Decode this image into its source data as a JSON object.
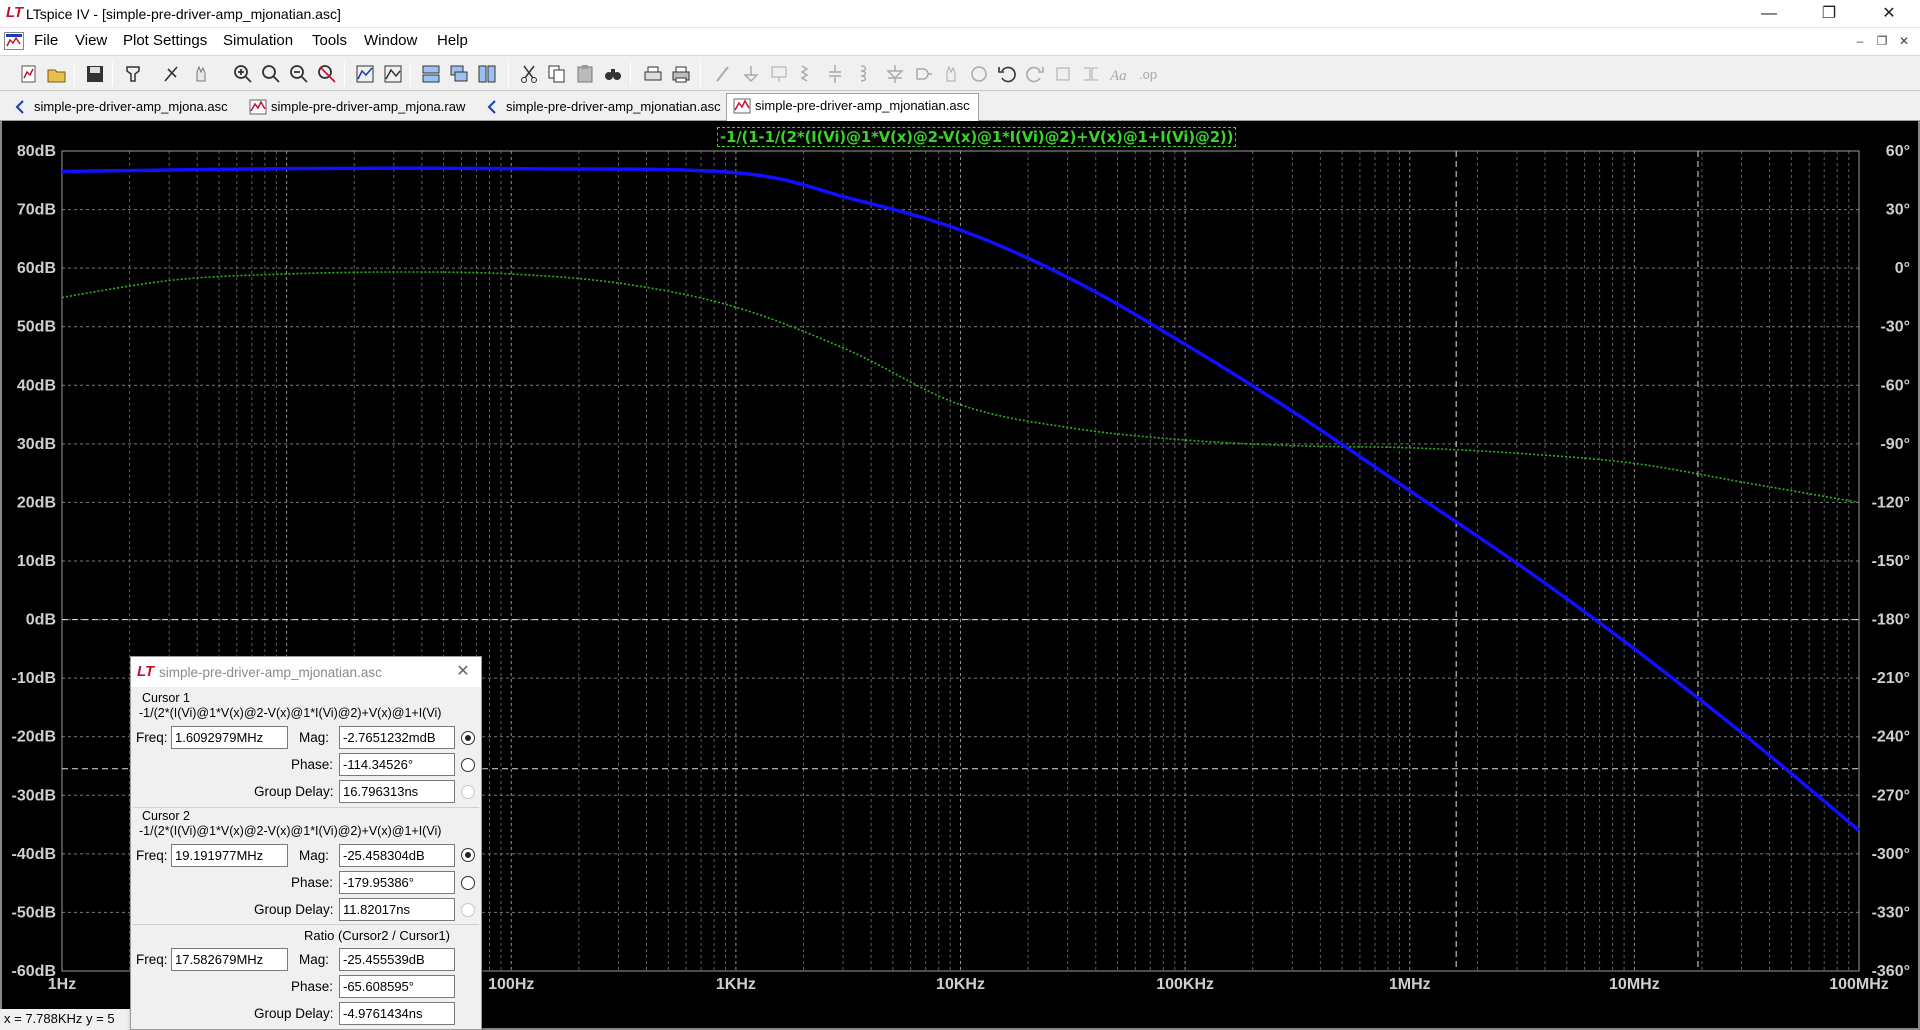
{
  "window": {
    "title": "LTspice IV - [simple-pre-driver-amp_mjonatian.asc]",
    "minimize": "—",
    "restore": "❐",
    "close": "✕"
  },
  "menu": {
    "items": [
      {
        "label": "File"
      },
      {
        "label": "View"
      },
      {
        "label": "Plot Settings"
      },
      {
        "label": "Simulation"
      },
      {
        "label": "Tools"
      },
      {
        "label": "Window"
      },
      {
        "label": "Help"
      }
    ],
    "mdi_minimize": "–",
    "mdi_restore": "❐",
    "mdi_close": "✕"
  },
  "tabs": [
    {
      "label": "simple-pre-driver-amp_mjona.asc",
      "icon": "schematic-icon"
    },
    {
      "label": "simple-pre-driver-amp_mjona.raw",
      "icon": "waveform-icon"
    },
    {
      "label": "simple-pre-driver-amp_mjonatian.asc",
      "icon": "schematic-icon"
    },
    {
      "label": "simple-pre-driver-amp_mjonatian.asc",
      "icon": "waveform-icon",
      "active": true
    }
  ],
  "plot": {
    "trace_expression": "-1/(1-1/(2*(I(Vi)@1*V(x)@2-V(x)@1*I(Vi)@2)+V(x)@1+I(Vi)@2))",
    "colors": {
      "magnitude": "#1010ff",
      "phase": "#2db51e",
      "grid": "#9a9a9a",
      "axis_text": "#cfcfcf"
    }
  },
  "chart_data": {
    "type": "line",
    "title": "-1/(1-1/(2*(I(Vi)@1*V(x)@2-V(x)@1*I(Vi)@2)+V(x)@1+I(Vi)@2))",
    "x_scale": "log",
    "x_ticks": [
      "1Hz",
      "10Hz",
      "100Hz",
      "1KHz",
      "10KHz",
      "100KHz",
      "1MHz",
      "10MHz",
      "100MHz"
    ],
    "y_left_ticks": [
      "80dB",
      "70dB",
      "60dB",
      "50dB",
      "40dB",
      "30dB",
      "20dB",
      "10dB",
      "0dB",
      "-10dB",
      "-20dB",
      "-30dB",
      "-40dB",
      "-50dB",
      "-60dB"
    ],
    "y_right_ticks": [
      "60°",
      "30°",
      "0°",
      "-30°",
      "-60°",
      "-90°",
      "-120°",
      "-150°",
      "-180°",
      "-210°",
      "-240°",
      "-270°",
      "-300°",
      "-330°",
      "-360°"
    ],
    "ylim_left": [
      -60,
      80
    ],
    "ylim_right": [
      -360,
      60
    ],
    "grid": true,
    "series": [
      {
        "kind": "magnitude_dB",
        "points": [
          [
            1,
            76.5
          ],
          [
            10,
            77
          ],
          [
            100,
            77
          ],
          [
            1000,
            76.3
          ],
          [
            3162,
            72
          ],
          [
            10000,
            66.5
          ],
          [
            31623,
            58
          ],
          [
            100000,
            47
          ],
          [
            316228,
            35
          ],
          [
            1000000,
            22
          ],
          [
            3162278,
            9
          ],
          [
            10000000,
            -5
          ],
          [
            31622777,
            -20
          ],
          [
            100000000,
            -36
          ],
          [
            316227766,
            -48
          ],
          [
            1000000000,
            -60
          ]
        ]
      },
      {
        "kind": "phase_deg",
        "points": [
          [
            1,
            -15
          ],
          [
            3.162,
            -6
          ],
          [
            10,
            -3
          ],
          [
            31.62,
            -2
          ],
          [
            100,
            -3
          ],
          [
            316.2,
            -8
          ],
          [
            1000,
            -20
          ],
          [
            3162,
            -42
          ],
          [
            10000,
            -70
          ],
          [
            31623,
            -82
          ],
          [
            100000,
            -88
          ],
          [
            316228,
            -91
          ],
          [
            1000000,
            -92
          ],
          [
            3162278,
            -95
          ],
          [
            10000000,
            -100
          ],
          [
            31622777,
            -110
          ],
          [
            100000000,
            -120
          ],
          [
            177827941,
            -130
          ],
          [
            316227766,
            -155
          ],
          [
            562341325,
            -180
          ],
          [
            1000000000,
            -220
          ],
          [
            1778279410,
            -260
          ],
          [
            3162277660,
            -292
          ],
          [
            4466835922,
            -300
          ],
          [
            6309573445,
            -290
          ],
          [
            10000000000,
            -278
          ]
        ]
      }
    ],
    "cursor_lines": {
      "x_freq_hz": [
        1609297.9,
        19191977
      ],
      "y_magnitude_db": [
        0,
        -25.46
      ]
    }
  },
  "statusbar": {
    "text": "x = 7.788KHz    y = 5"
  },
  "cursor_window": {
    "title": "simple-pre-driver-amp_mjonatian.asc",
    "cursor1": {
      "heading": "Cursor 1",
      "expr": "-1/(2*(I(Vi)@1*V(x)@2-V(x)@1*I(Vi)@2)+V(x)@1+I(Vi)",
      "freq_label": "Freq:",
      "freq": "1.6092979MHz",
      "mag_label": "Mag:",
      "mag": "-2.7651232mdB",
      "phase_label": "Phase:",
      "phase": "-114.34526°",
      "gd_label": "Group Delay:",
      "gd": "16.796313ns"
    },
    "cursor2": {
      "heading": "Cursor 2",
      "expr": "-1/(2*(I(Vi)@1*V(x)@2-V(x)@1*I(Vi)@2)+V(x)@1+I(Vi)",
      "freq_label": "Freq:",
      "freq": "19.191977MHz",
      "mag_label": "Mag:",
      "mag": "-25.458304dB",
      "phase_label": "Phase:",
      "phase": "-179.95386°",
      "gd_label": "Group Delay:",
      "gd": "11.82017ns"
    },
    "ratio": {
      "heading": "Ratio (Cursor2 / Cursor1)",
      "freq_label": "Freq:",
      "freq": "17.582679MHz",
      "mag_label": "Mag:",
      "mag": "-25.455539dB",
      "phase_label": "Phase:",
      "phase": "-65.608595°",
      "gd_label": "Group Delay:",
      "gd": "-4.9761434ns"
    }
  }
}
